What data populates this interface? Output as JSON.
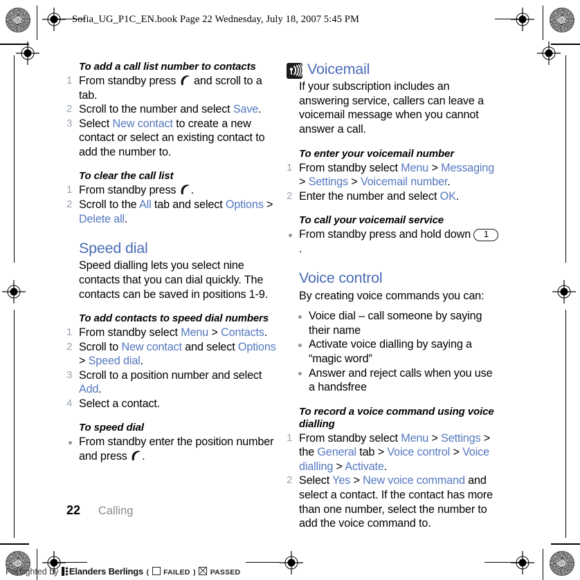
{
  "header": {
    "file_line": "Sofia_UG_P1C_EN.book  Page 22  Wednesday, July 18, 2007  5:45 PM"
  },
  "left_column": {
    "section_1": {
      "heading": "To add a call list number to contacts",
      "steps": [
        {
          "num": "1",
          "parts": [
            {
              "t": "From standby press ",
              "k": "plain"
            },
            {
              "t": "",
              "k": "handset"
            },
            {
              "t": " and scroll to a tab.",
              "k": "plain"
            }
          ]
        },
        {
          "num": "2",
          "parts": [
            {
              "t": "Scroll to the number and select ",
              "k": "plain"
            },
            {
              "t": "Save",
              "k": "link"
            },
            {
              "t": ".",
              "k": "plain"
            }
          ]
        },
        {
          "num": "3",
          "parts": [
            {
              "t": "Select ",
              "k": "plain"
            },
            {
              "t": "New contact",
              "k": "link"
            },
            {
              "t": " to create a new contact or select an existing contact to add the number to.",
              "k": "plain"
            }
          ]
        }
      ]
    },
    "section_2": {
      "heading": "To clear the call list",
      "steps": [
        {
          "num": "1",
          "parts": [
            {
              "t": "From standby press ",
              "k": "plain"
            },
            {
              "t": "",
              "k": "handset"
            },
            {
              "t": ".",
              "k": "plain"
            }
          ]
        },
        {
          "num": "2",
          "parts": [
            {
              "t": "Scroll to the ",
              "k": "plain"
            },
            {
              "t": "All",
              "k": "link"
            },
            {
              "t": " tab and select ",
              "k": "plain"
            },
            {
              "t": "Options",
              "k": "link"
            },
            {
              "t": " > ",
              "k": "plain"
            },
            {
              "t": "Delete all",
              "k": "link"
            },
            {
              "t": ".",
              "k": "plain"
            }
          ]
        }
      ]
    },
    "speed_dial": {
      "title": "Speed dial",
      "body": "Speed dialling lets you select nine contacts that you can dial quickly. The contacts can be saved in positions 1-9.",
      "section_3": {
        "heading": "To add contacts to speed dial numbers",
        "steps": [
          {
            "num": "1",
            "parts": [
              {
                "t": "From standby select ",
                "k": "plain"
              },
              {
                "t": "Menu",
                "k": "link"
              },
              {
                "t": " > ",
                "k": "plain"
              },
              {
                "t": "Contacts",
                "k": "link"
              },
              {
                "t": ".",
                "k": "plain"
              }
            ]
          },
          {
            "num": "2",
            "parts": [
              {
                "t": "Scroll to ",
                "k": "plain"
              },
              {
                "t": "New contact",
                "k": "link"
              },
              {
                "t": " and select ",
                "k": "plain"
              },
              {
                "t": "Options",
                "k": "link"
              },
              {
                "t": " > ",
                "k": "plain"
              },
              {
                "t": "Speed dial",
                "k": "link"
              },
              {
                "t": ".",
                "k": "plain"
              }
            ]
          },
          {
            "num": "3",
            "parts": [
              {
                "t": "Scroll to a position number and select ",
                "k": "plain"
              },
              {
                "t": "Add",
                "k": "link"
              },
              {
                "t": ".",
                "k": "plain"
              }
            ]
          },
          {
            "num": "4",
            "parts": [
              {
                "t": "Select a contact.",
                "k": "plain"
              }
            ]
          }
        ]
      },
      "section_4": {
        "heading": "To speed dial",
        "bullets": [
          {
            "parts": [
              {
                "t": "From standby enter the position number and press ",
                "k": "plain"
              },
              {
                "t": "",
                "k": "handset"
              },
              {
                "t": ".",
                "k": "plain"
              }
            ]
          }
        ]
      }
    }
  },
  "right_column": {
    "voicemail": {
      "icon": "voicemail-icon",
      "title": "Voicemail",
      "body": "If your subscription includes an answering service, callers can leave a voicemail message when you cannot answer a call.",
      "section_1": {
        "heading": "To enter your voicemail number",
        "steps": [
          {
            "num": "1",
            "parts": [
              {
                "t": "From standby select ",
                "k": "plain"
              },
              {
                "t": "Menu",
                "k": "link"
              },
              {
                "t": " > ",
                "k": "plain"
              },
              {
                "t": "Messaging",
                "k": "link"
              },
              {
                "t": " > ",
                "k": "plain"
              },
              {
                "t": "Settings",
                "k": "link"
              },
              {
                "t": " > ",
                "k": "plain"
              },
              {
                "t": "Voicemail number",
                "k": "link"
              },
              {
                "t": ".",
                "k": "plain"
              }
            ]
          },
          {
            "num": "2",
            "parts": [
              {
                "t": "Enter the number and select ",
                "k": "plain"
              },
              {
                "t": "OK",
                "k": "link"
              },
              {
                "t": ".",
                "k": "plain"
              }
            ]
          }
        ]
      },
      "section_2": {
        "heading": "To call your voicemail service",
        "bullets": [
          {
            "parts": [
              {
                "t": "From standby press and hold down ",
                "k": "plain"
              },
              {
                "t": "1",
                "k": "key"
              },
              {
                "t": ".",
                "k": "plain"
              }
            ]
          }
        ]
      }
    },
    "voice_control": {
      "title": "Voice control",
      "body": "By creating voice commands you can:",
      "bullets": [
        {
          "parts": [
            {
              "t": "Voice dial – call someone by saying their name",
              "k": "plain"
            }
          ]
        },
        {
          "parts": [
            {
              "t": "Activate voice dialling by saying a “magic word”",
              "k": "plain"
            }
          ]
        },
        {
          "parts": [
            {
              "t": "Answer and reject calls when you use a handsfree",
              "k": "plain"
            }
          ]
        }
      ],
      "section_1": {
        "heading": "To record a voice command using voice dialling",
        "steps": [
          {
            "num": "1",
            "parts": [
              {
                "t": "From standby select ",
                "k": "plain"
              },
              {
                "t": "Menu",
                "k": "link"
              },
              {
                "t": " > ",
                "k": "plain"
              },
              {
                "t": "Settings",
                "k": "link"
              },
              {
                "t": " > the ",
                "k": "plain"
              },
              {
                "t": "General",
                "k": "link"
              },
              {
                "t": " tab > ",
                "k": "plain"
              },
              {
                "t": "Voice control",
                "k": "link"
              },
              {
                "t": " > ",
                "k": "plain"
              },
              {
                "t": "Voice dialling",
                "k": "link"
              },
              {
                "t": " > ",
                "k": "plain"
              },
              {
                "t": "Activate",
                "k": "link"
              },
              {
                "t": ".",
                "k": "plain"
              }
            ]
          },
          {
            "num": "2",
            "parts": [
              {
                "t": "Select ",
                "k": "plain"
              },
              {
                "t": "Yes",
                "k": "link"
              },
              {
                "t": " > ",
                "k": "plain"
              },
              {
                "t": "New voice command",
                "k": "link"
              },
              {
                "t": " and select a contact. If the contact has more than one number, select the number to add the voice command to.",
                "k": "plain"
              }
            ]
          }
        ]
      }
    }
  },
  "footer": {
    "page_number": "22",
    "chapter": "Calling"
  },
  "preflight": {
    "prefix": "Preflighted by",
    "brand": "Elanders Berlings",
    "open_paren": "(",
    "failed_label": "FAILED",
    "close_paren": ")",
    "passed_label": "PASSED"
  },
  "colors": {
    "link": "#5578c0",
    "heading": "#4a6bb5",
    "step_number": "#9aa3ad",
    "chapter": "#8a8a8a"
  }
}
